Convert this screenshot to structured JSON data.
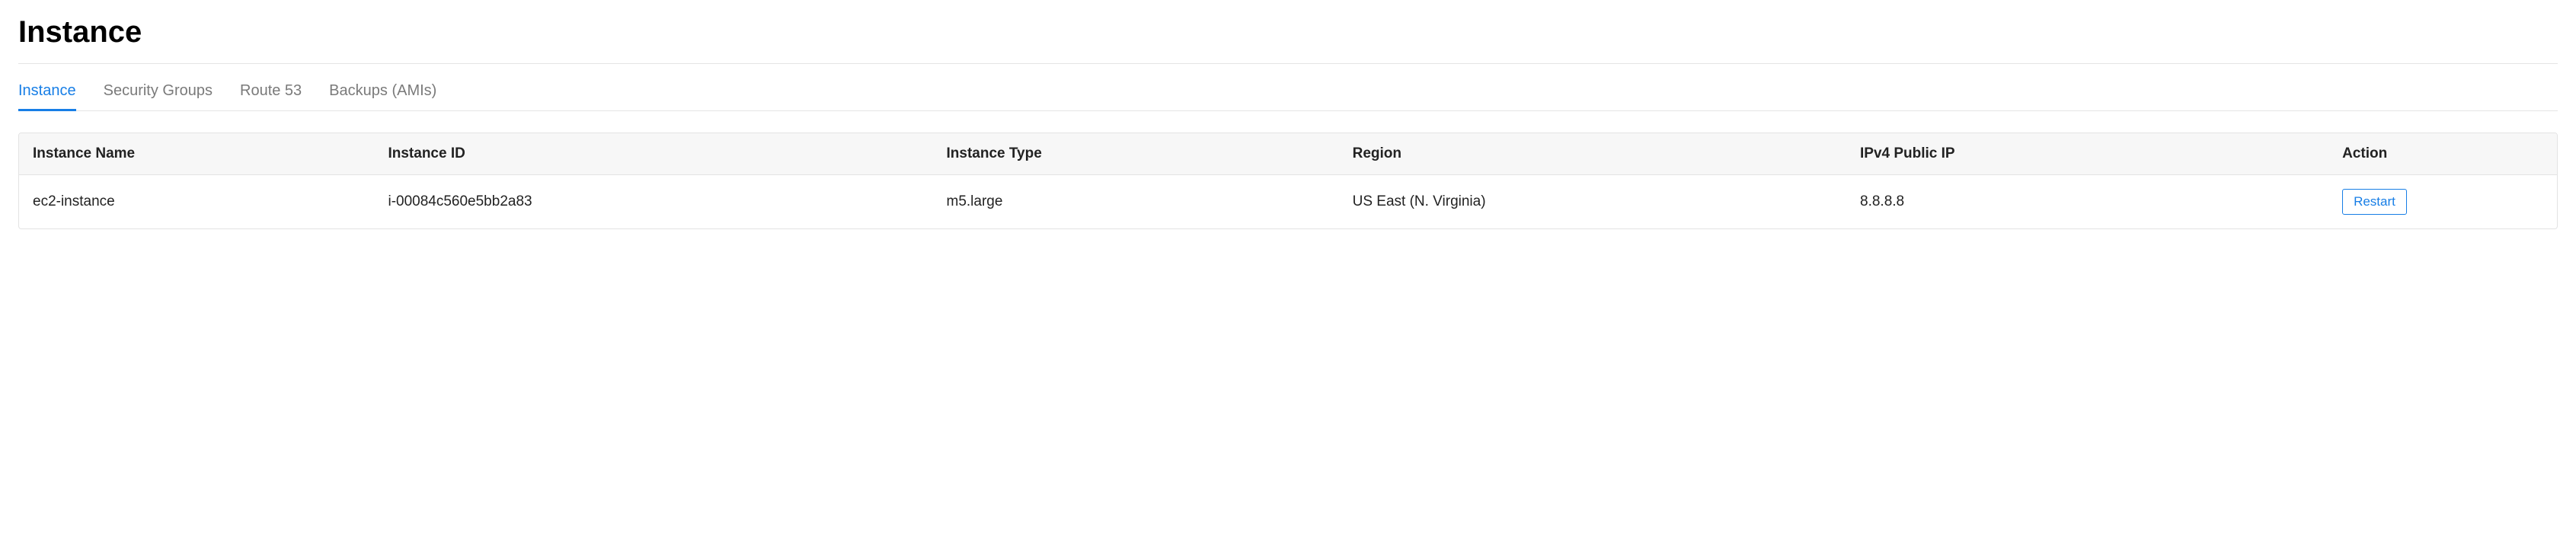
{
  "header": {
    "title": "Instance"
  },
  "tabs": [
    {
      "label": "Instance",
      "active": true
    },
    {
      "label": "Security Groups",
      "active": false
    },
    {
      "label": "Route 53",
      "active": false
    },
    {
      "label": "Backups (AMIs)",
      "active": false
    }
  ],
  "table": {
    "headers": {
      "name": "Instance Name",
      "id": "Instance ID",
      "type": "Instance Type",
      "region": "Region",
      "ip": "IPv4 Public IP",
      "action": "Action"
    },
    "rows": [
      {
        "name": "ec2-instance",
        "id": "i-00084c560e5bb2a83",
        "type": "m5.large",
        "region": "US East (N. Virginia)",
        "ip": "8.8.8.8",
        "action_label": "Restart"
      }
    ]
  }
}
